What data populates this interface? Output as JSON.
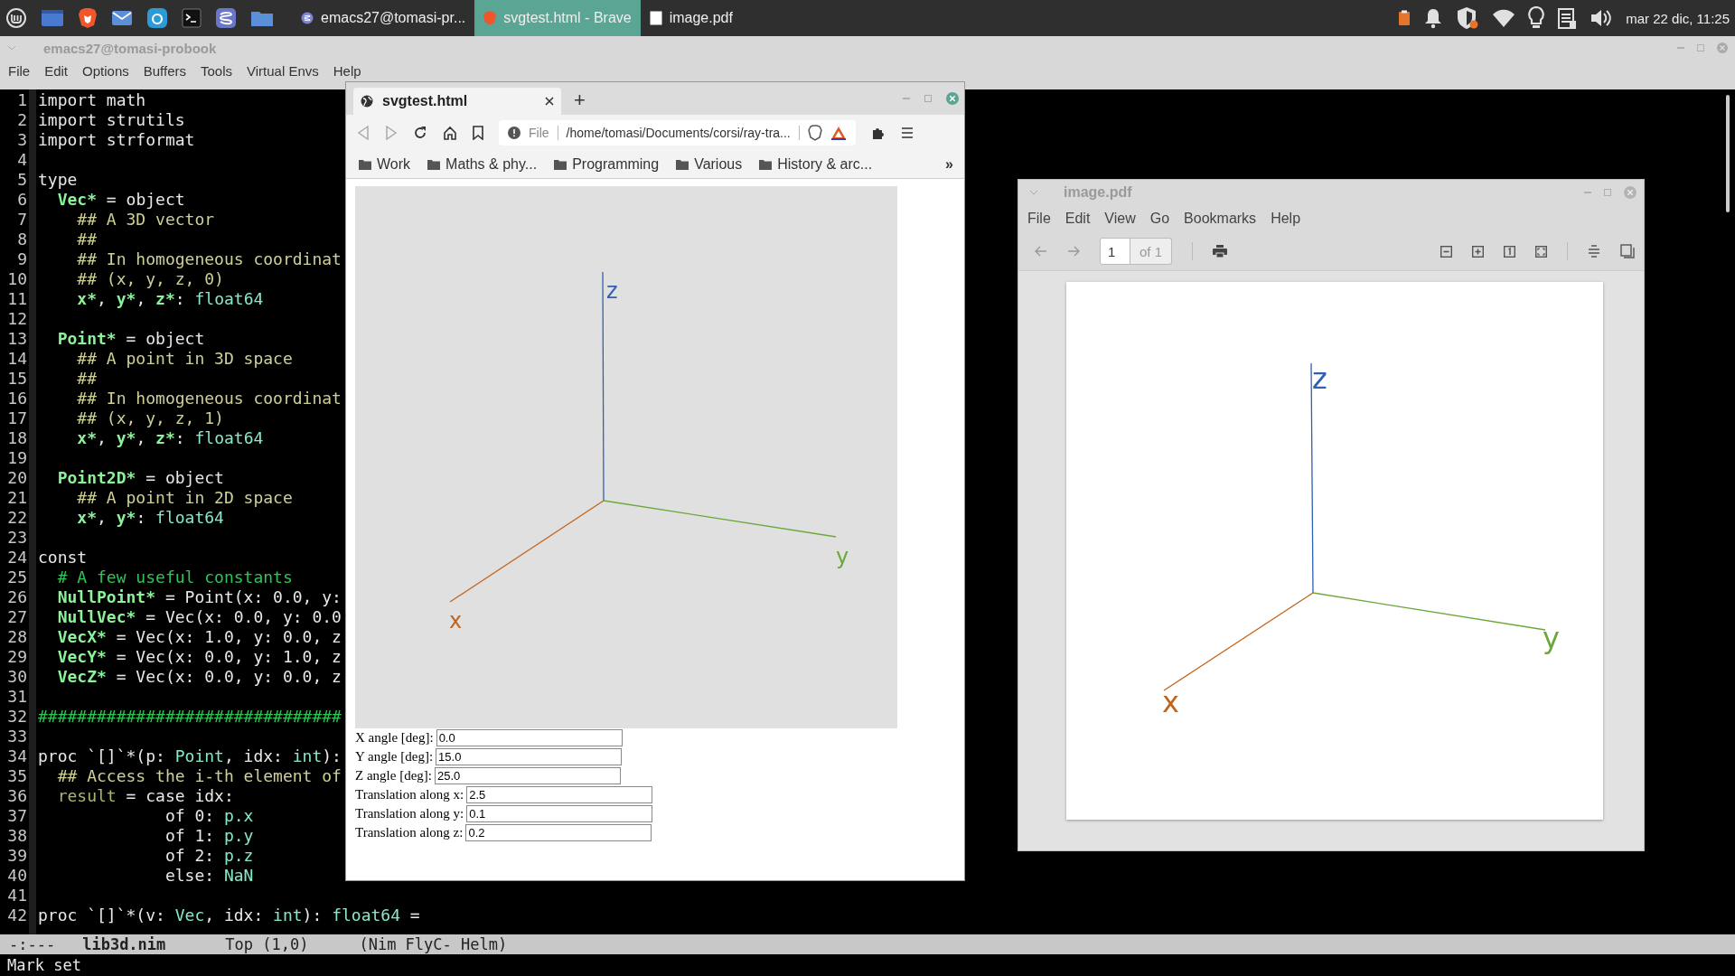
{
  "taskbar": {
    "tasks": [
      {
        "kind": "emacs",
        "label": "emacs27@tomasi-pr...",
        "selected": false
      },
      {
        "kind": "brave",
        "label": "svgtest.html - Brave",
        "selected": true
      },
      {
        "kind": "document",
        "label": "image.pdf",
        "selected": false
      }
    ],
    "clock": "mar 22 dic, 11:25"
  },
  "emacs": {
    "title": "emacs27@tomasi-probook",
    "menu": [
      "File",
      "Edit",
      "Options",
      "Buffers",
      "Tools",
      "Virtual Envs",
      "Help"
    ],
    "lines": [
      {
        "number": "1",
        "segments": [
          {
            "kind": "plain",
            "text": "import math"
          }
        ]
      },
      {
        "number": "2",
        "segments": [
          {
            "kind": "plain",
            "text": "import strutils"
          }
        ]
      },
      {
        "number": "3",
        "segments": [
          {
            "kind": "plain",
            "text": "import strformat"
          }
        ]
      },
      {
        "number": "4"
      },
      {
        "number": "5",
        "segments": [
          {
            "kind": "plain",
            "text": "type"
          }
        ]
      },
      {
        "number": "6",
        "segments": [
          {
            "kind": "decl",
            "text": "  Vec*"
          },
          {
            "kind": "plain",
            "text": " = object"
          }
        ]
      },
      {
        "number": "7",
        "segments": [
          {
            "kind": "doc",
            "text": "    ## A 3D vector"
          }
        ]
      },
      {
        "number": "8",
        "segments": [
          {
            "kind": "doc",
            "text": "    ##"
          }
        ]
      },
      {
        "number": "9",
        "segments": [
          {
            "kind": "doc",
            "text": "    ## In homogeneous coordinat"
          }
        ]
      },
      {
        "number": "10",
        "segments": [
          {
            "kind": "doc",
            "text": "    ## (x, y, z, 0)"
          }
        ]
      },
      {
        "number": "11",
        "segments": [
          {
            "kind": "decl",
            "text": "    x*"
          },
          {
            "kind": "plain",
            "text": ", "
          },
          {
            "kind": "decl",
            "text": "y*"
          },
          {
            "kind": "plain",
            "text": ", "
          },
          {
            "kind": "decl",
            "text": "z*"
          },
          {
            "kind": "plain",
            "text": ": "
          },
          {
            "kind": "type",
            "text": "float64"
          }
        ]
      },
      {
        "number": "12"
      },
      {
        "number": "13",
        "segments": [
          {
            "kind": "decl",
            "text": "  Point*"
          },
          {
            "kind": "plain",
            "text": " = object"
          }
        ]
      },
      {
        "number": "14",
        "segments": [
          {
            "kind": "doc",
            "text": "    ## A point in 3D space"
          }
        ]
      },
      {
        "number": "15",
        "segments": [
          {
            "kind": "doc",
            "text": "    ##"
          }
        ]
      },
      {
        "number": "16",
        "segments": [
          {
            "kind": "doc",
            "text": "    ## In homogeneous coordinat"
          }
        ]
      },
      {
        "number": "17",
        "segments": [
          {
            "kind": "doc",
            "text": "    ## (x, y, z, 1)"
          }
        ]
      },
      {
        "number": "18",
        "segments": [
          {
            "kind": "decl",
            "text": "    x*"
          },
          {
            "kind": "plain",
            "text": ", "
          },
          {
            "kind": "decl",
            "text": "y*"
          },
          {
            "kind": "plain",
            "text": ", "
          },
          {
            "kind": "decl",
            "text": "z*"
          },
          {
            "kind": "plain",
            "text": ": "
          },
          {
            "kind": "type",
            "text": "float64"
          }
        ]
      },
      {
        "number": "19"
      },
      {
        "number": "20",
        "segments": [
          {
            "kind": "decl",
            "text": "  Point2D*"
          },
          {
            "kind": "plain",
            "text": " = object"
          }
        ]
      },
      {
        "number": "21",
        "segments": [
          {
            "kind": "doc",
            "text": "    ## A point in 2D space"
          }
        ]
      },
      {
        "number": "22",
        "segments": [
          {
            "kind": "decl",
            "text": "    x*"
          },
          {
            "kind": "plain",
            "text": ", "
          },
          {
            "kind": "decl",
            "text": "y*"
          },
          {
            "kind": "plain",
            "text": ": "
          },
          {
            "kind": "type",
            "text": "float64"
          }
        ]
      },
      {
        "number": "23"
      },
      {
        "number": "24",
        "segments": [
          {
            "kind": "plain",
            "text": "const"
          }
        ]
      },
      {
        "number": "25",
        "segments": [
          {
            "kind": "comment",
            "text": "  # A few useful constants"
          }
        ]
      },
      {
        "number": "26",
        "segments": [
          {
            "kind": "decl",
            "text": "  NullPoint*"
          },
          {
            "kind": "plain",
            "text": " = Point(x: 0.0, y:"
          }
        ]
      },
      {
        "number": "27",
        "segments": [
          {
            "kind": "decl",
            "text": "  NullVec*"
          },
          {
            "kind": "plain",
            "text": " = Vec(x: 0.0, y: 0.0"
          }
        ]
      },
      {
        "number": "28",
        "segments": [
          {
            "kind": "decl",
            "text": "  VecX*"
          },
          {
            "kind": "plain",
            "text": " = Vec(x: 1.0, y: 0.0, z"
          }
        ]
      },
      {
        "number": "29",
        "segments": [
          {
            "kind": "decl",
            "text": "  VecY*"
          },
          {
            "kind": "plain",
            "text": " = Vec(x: 0.0, y: 1.0, z"
          }
        ]
      },
      {
        "number": "30",
        "segments": [
          {
            "kind": "decl",
            "text": "  VecZ*"
          },
          {
            "kind": "plain",
            "text": " = Vec(x: 0.0, y: 0.0, z"
          }
        ]
      },
      {
        "number": "31"
      },
      {
        "number": "32",
        "segments": [
          {
            "kind": "comment",
            "text": "###############################"
          }
        ]
      },
      {
        "number": "33"
      },
      {
        "number": "34",
        "segments": [
          {
            "kind": "plain",
            "text": "proc `[]`*(p: "
          },
          {
            "kind": "type",
            "text": "Point"
          },
          {
            "kind": "plain",
            "text": ", idx: "
          },
          {
            "kind": "type",
            "text": "int"
          },
          {
            "kind": "plain",
            "text": "):"
          }
        ]
      },
      {
        "number": "35",
        "segments": [
          {
            "kind": "doc",
            "text": "  ## Access the i-th element of"
          }
        ]
      },
      {
        "number": "36",
        "segments": [
          {
            "kind": "var",
            "text": "  result"
          },
          {
            "kind": "plain",
            "text": " = case idx:"
          }
        ]
      },
      {
        "number": "37",
        "segments": [
          {
            "kind": "plain",
            "text": "             of 0: "
          },
          {
            "kind": "type",
            "text": "p.x"
          }
        ]
      },
      {
        "number": "38",
        "segments": [
          {
            "kind": "plain",
            "text": "             of 1: "
          },
          {
            "kind": "type",
            "text": "p.y"
          }
        ]
      },
      {
        "number": "39",
        "segments": [
          {
            "kind": "plain",
            "text": "             of 2: "
          },
          {
            "kind": "type",
            "text": "p.z"
          }
        ]
      },
      {
        "number": "40",
        "segments": [
          {
            "kind": "plain",
            "text": "             else: "
          },
          {
            "kind": "type",
            "text": "NaN"
          }
        ]
      },
      {
        "number": "41"
      },
      {
        "number": "42",
        "segments": [
          {
            "kind": "plain",
            "text": "proc `[]`*(v: "
          },
          {
            "kind": "type",
            "text": "Vec"
          },
          {
            "kind": "plain",
            "text": ", idx: "
          },
          {
            "kind": "type",
            "text": "int"
          },
          {
            "kind": "plain",
            "text": "): "
          },
          {
            "kind": "type",
            "text": "float64"
          },
          {
            "kind": "plain",
            "text": " ="
          }
        ]
      }
    ],
    "modeline": {
      "state": "-:---",
      "buffer": "lib3d.nim",
      "position": "Top (1,0)",
      "modes": "(Nim FlyC- Helm)"
    },
    "minibuffer": "Mark set"
  },
  "browser": {
    "tabs": [
      {
        "label": "svgtest.html",
        "selected": true
      }
    ],
    "new_tab": "+",
    "url_scheme": "File",
    "url": "/home/tomasi/Documents/corsi/ray-tra...",
    "bookmarks": [
      "Work",
      "Maths & phy...",
      "Programming",
      "Various",
      "History & arc..."
    ],
    "bookmarks_overflow": "»",
    "axes": {
      "x": "x",
      "y": "y",
      "z": "z"
    },
    "form": [
      {
        "label": "X angle [deg]:",
        "value": "0.0"
      },
      {
        "label": "Y angle [deg]:",
        "value": "15.0"
      },
      {
        "label": "Z angle [deg]:",
        "value": "25.0"
      },
      {
        "label": "Translation along x:",
        "value": "2.5"
      },
      {
        "label": "Translation along y:",
        "value": "0.1"
      },
      {
        "label": "Translation along z:",
        "value": "0.2"
      }
    ]
  },
  "pdf_viewer": {
    "title": "image.pdf",
    "menu": [
      "File",
      "Edit",
      "View",
      "Go",
      "Bookmarks",
      "Help"
    ],
    "page": "1",
    "page_count": "of 1",
    "axes": {
      "x": "x",
      "y": "y",
      "z": "z"
    }
  }
}
